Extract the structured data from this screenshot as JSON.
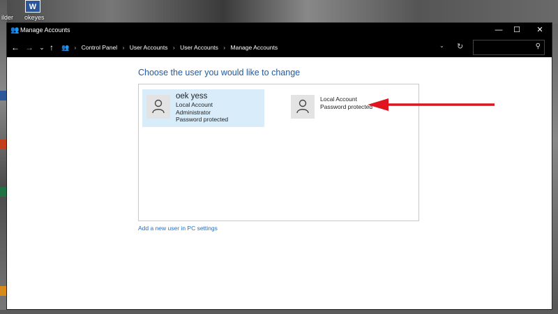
{
  "desktop": {
    "labels": [
      "ilder",
      "okeyes"
    ],
    "word_icon": "W"
  },
  "window": {
    "title": "Manage Accounts",
    "controls": {
      "minimize": "—",
      "maximize": "☐",
      "close": "✕"
    }
  },
  "navigation": {
    "back": "←",
    "forward": "→",
    "recent": "⌄",
    "up": "↑"
  },
  "breadcrumb": [
    "Control Panel",
    "User Accounts",
    "User Accounts",
    "Manage Accounts"
  ],
  "search": {
    "placeholder": ""
  },
  "main": {
    "title": "Choose the user you would like to change",
    "accounts": [
      {
        "name": "oek yess",
        "lines": [
          "Local Account",
          "Administrator",
          "Password protected"
        ],
        "selected": true
      },
      {
        "name": "",
        "lines": [
          "Local Account",
          "Password protected"
        ],
        "selected": false
      }
    ],
    "add_user_link": "Add a new user in PC settings"
  },
  "annotation": {
    "arrow_color": "#e0141e"
  },
  "colors": {
    "accent_title": "#1e5aa0",
    "link": "#1e6fc8",
    "selected_bg": "#d9ecfa"
  }
}
